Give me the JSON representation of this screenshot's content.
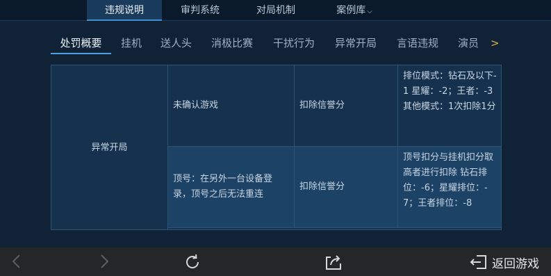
{
  "top_tabs": [
    {
      "label": "违规说明"
    },
    {
      "label": "审判系统"
    },
    {
      "label": "对局机制"
    },
    {
      "label": "案例库"
    }
  ],
  "sub_tabs": [
    {
      "label": "处罚概要"
    },
    {
      "label": "挂机"
    },
    {
      "label": "送人头"
    },
    {
      "label": "消极比赛"
    },
    {
      "label": "干扰行为"
    },
    {
      "label": "异常开局"
    },
    {
      "label": "言语违规"
    },
    {
      "label": "演员"
    }
  ],
  "more_symbol": ">",
  "table": {
    "category": "异常开局",
    "rows": [
      {
        "behavior": "未确认游戏",
        "penalty": "扣除信誉分",
        "detail": "排位模式：钻石及以下-1 星耀：-2；王者：-3\n其他模式：1次扣除1分"
      },
      {
        "behavior": "顶号：在另外一台设备登录，顶号之后无法重连",
        "penalty": "扣除信誉分",
        "detail": "顶号扣分与挂机扣分取高者进行扣除 钻石排位：-6；星耀排位：-7；王者排位：-8"
      }
    ]
  },
  "bottom_bar": {
    "back_game_label": "返回游戏",
    "icons": [
      "back-arrow-icon",
      "forward-arrow-icon",
      "refresh-icon",
      "share-icon",
      "exit-icon"
    ]
  },
  "colors": {
    "accent": "#3d8fd1",
    "more": "#e0b04a",
    "background": "#0f2236",
    "bottom_bar": "#242628"
  }
}
